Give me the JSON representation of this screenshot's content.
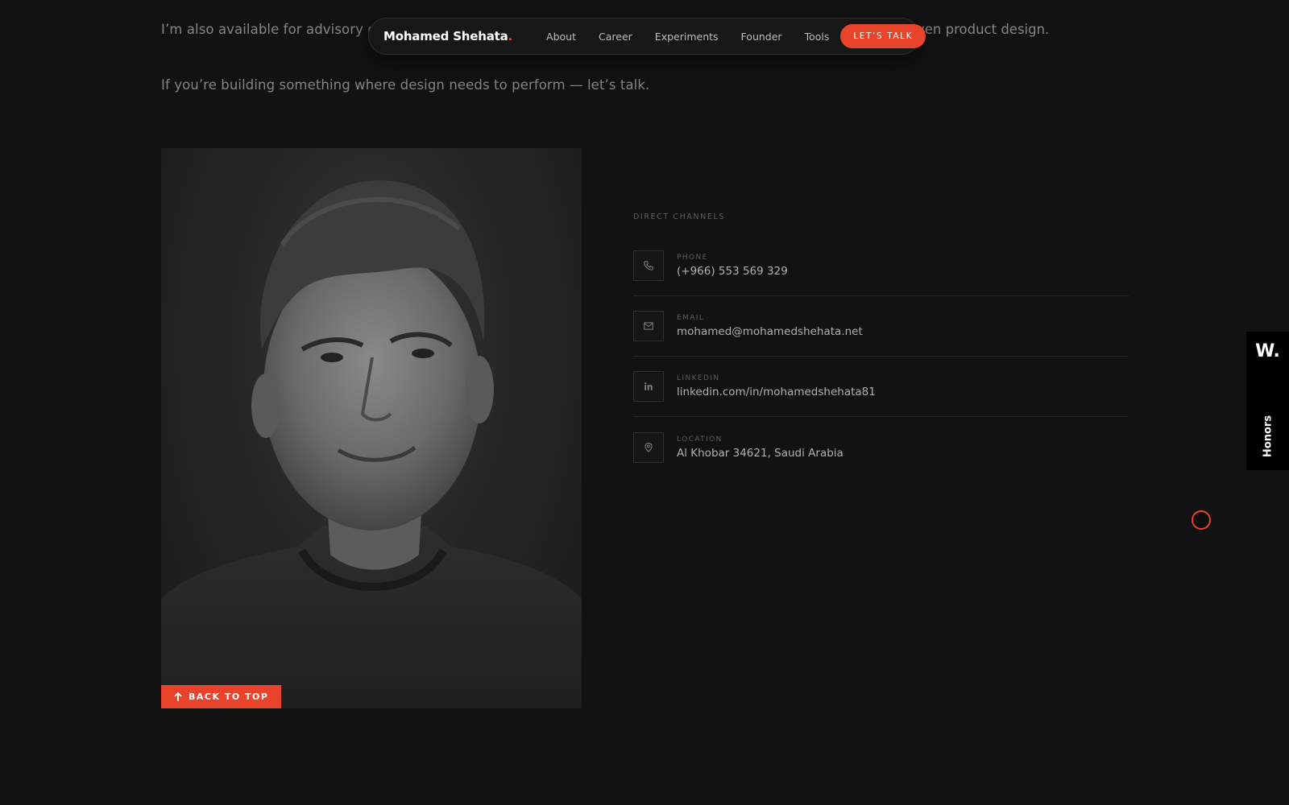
{
  "intro": {
    "line1_start": "I’m also available for advisory eng",
    "line1_end": "ven product design.",
    "line2": "If you’re building something where design needs to perform — let’s talk."
  },
  "nav": {
    "brand": "Mohamed Shehata",
    "brand_dot": ".",
    "links": [
      "About",
      "Career",
      "Experiments",
      "Founder",
      "Tools"
    ],
    "cta": "LET’S TALK"
  },
  "back_to_top": "BACK TO TOP",
  "channels": {
    "heading": "DIRECT CHANNELS",
    "items": [
      {
        "label": "PHONE",
        "value": "(+966) 553 569 329",
        "icon": "phone-icon"
      },
      {
        "label": "EMAIL",
        "value": "mohamed@mohamedshehata.net",
        "icon": "mail-icon"
      },
      {
        "label": "LINKEDIN",
        "value": "linkedin.com/in/mohamedshehata81",
        "icon": "linkedin-icon"
      },
      {
        "label": "LOCATION",
        "value": "Al Khobar 34621, Saudi Arabia",
        "icon": "map-pin-icon"
      }
    ]
  },
  "side_badge": {
    "logo": "W.",
    "text": "Honors"
  },
  "colors": {
    "background": "#121212",
    "accent": "#e8432b",
    "muted_text": "#858585"
  }
}
